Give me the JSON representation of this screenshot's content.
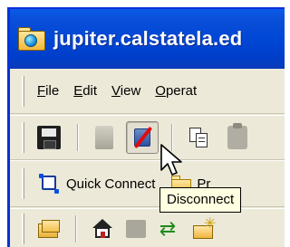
{
  "window": {
    "title": "jupiter.calstatela.ed",
    "title_icon": "ftp-folder-globe-icon"
  },
  "menu": {
    "items": [
      {
        "accel": "F",
        "rest": "ile"
      },
      {
        "accel": "E",
        "rest": "dit"
      },
      {
        "accel": "V",
        "rest": "iew"
      },
      {
        "accel": "O",
        "rest": "perat"
      }
    ]
  },
  "toolbar": {
    "icons": [
      "floppy-save-icon",
      "connect-icon",
      "disconnect-icon",
      "copy-icon",
      "paste-icon"
    ],
    "quick_connect_label": "Quick Connect",
    "profiles_label": "Pr",
    "nav_icons": [
      "up-folder-icon",
      "home-icon",
      "image-icon",
      "refresh-icon",
      "new-folder-icon"
    ]
  },
  "tooltip": {
    "text": "Disconnect"
  },
  "colors": {
    "titlebar": "#0047d6",
    "chrome": "#ece9d8",
    "tooltip_bg": "#ffffe1"
  }
}
